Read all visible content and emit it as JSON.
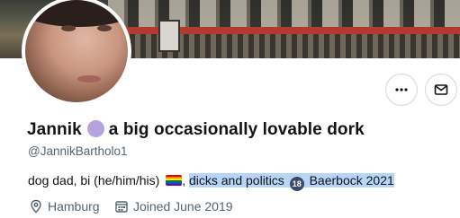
{
  "profile": {
    "display_name_first": "Jannik",
    "display_name_rest": "a big occasionally lovable dork",
    "handle": "@JannikBartholo1",
    "bio": {
      "text_start": "dog dad, bi (he/him/his)",
      "after_flag": ",",
      "highlight_text_1": "dicks and politics",
      "age_badge": "18",
      "highlight_text_2": "Baerbock 2021"
    },
    "location": "Hamburg",
    "joined": "Joined June 2019"
  },
  "actions": {
    "more_icon": "more-horizontal-icon",
    "message_icon": "envelope-icon"
  },
  "colors": {
    "highlight": "#b8d4f7",
    "name_dot": "#b6a2df",
    "secondary_text": "#536471"
  }
}
